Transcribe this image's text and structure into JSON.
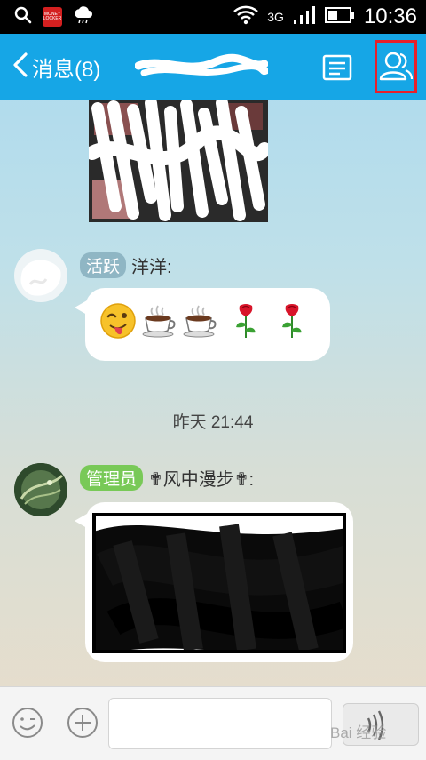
{
  "status_bar": {
    "app_badge_text": "MONEY LOCKER",
    "network": "3G",
    "time": "10:36"
  },
  "header": {
    "back_label": "消息(8)",
    "title_redacted": true
  },
  "messages": [
    {
      "type": "image",
      "redacted": true
    },
    {
      "badge": "活跃",
      "sender": "洋洋:",
      "emojis": [
        "tongue-wink-emoji",
        "coffee-emoji",
        "coffee-emoji",
        "rose-emoji",
        "rose-emoji"
      ]
    },
    {
      "badge": "管理员",
      "sender": "✟风中漫步✟:",
      "type": "image",
      "redacted": true
    }
  ],
  "timestamp": "昨天 21:44",
  "input": {
    "value": "",
    "placeholder": ""
  },
  "watermark": "Bai 经验",
  "colors": {
    "header_bg": "#16a6e6",
    "highlight_box": "#e8202a",
    "badge_active": "#8fb6c4",
    "badge_admin": "#78c957"
  }
}
